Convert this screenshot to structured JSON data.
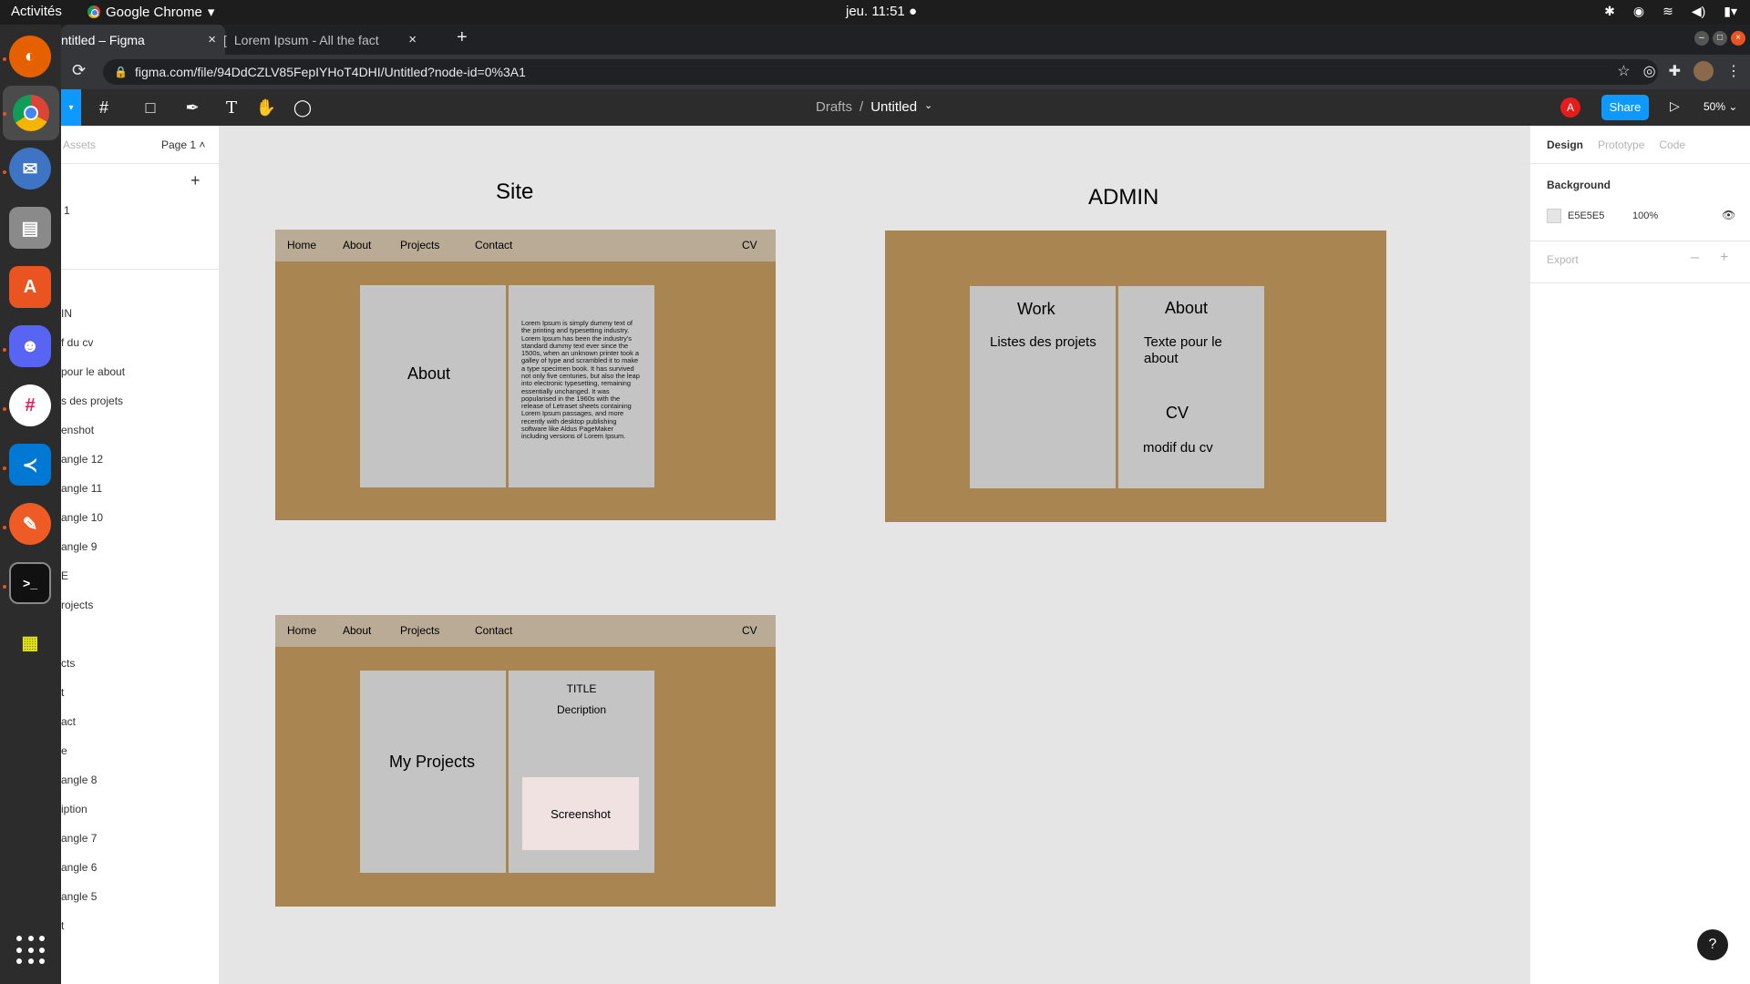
{
  "os": {
    "activities": "Activités",
    "app_name": "Google Chrome",
    "clock": "jeu. 11:51 ●"
  },
  "browser": {
    "tabs": [
      {
        "title": "ntitled – Figma",
        "close": "×"
      },
      {
        "title": "Lorem Ipsum - All the fact",
        "close": "×"
      }
    ],
    "new_tab": "+",
    "url": "figma.com/file/94DdCZLV85FepIYHoT4DHI/Untitled?node-id=0%3A1"
  },
  "figma": {
    "breadcrumb": {
      "drafts": "Drafts",
      "separator": "/",
      "file": "Untitled"
    },
    "user_initial": "A",
    "share": "Share",
    "zoom": "50%",
    "left_panel": {
      "assets": "Assets",
      "page_selector": "Page 1",
      "page_item": "1",
      "layers": [
        "IN",
        "f du cv",
        "pour le about",
        "s des projets",
        "enshot",
        "angle 12",
        "angle 11",
        "angle 10",
        "angle 9",
        "E",
        "rojects",
        "cts",
        "t",
        "act",
        "e",
        "angle 8",
        "iption",
        "angle 7",
        "angle 6",
        "angle 5",
        "t"
      ]
    },
    "right_panel": {
      "tabs": [
        "Design",
        "Prototype",
        "Code"
      ],
      "background_label": "Background",
      "background_hex": "E5E5E5",
      "background_opacity": "100%",
      "export_label": "Export",
      "help": "?"
    }
  },
  "canvas": {
    "site_title": "Site",
    "admin_title": "ADMIN",
    "nav": {
      "home": "Home",
      "about": "About",
      "projects": "Projects",
      "contact": "Contact",
      "cv": "CV"
    },
    "about_frame": {
      "box_title": "About",
      "lorem": "Lorem Ipsum is simply dummy text of the printing and typesetting industry. Lorem Ipsum has been the industry's standard dummy text ever since the 1500s, when an unknown printer took a galley of type and scrambled it to make a type specimen book. It has survived not only five centuries, but also the leap into electronic typesetting, remaining essentially unchanged. It was popularised in the 1960s with the release of Letraset sheets containing Lorem Ipsum passages, and more recently with desktop publishing software like Aldus PageMaker including versions of Lorem Ipsum."
    },
    "projects_frame": {
      "box_title": "My Projects",
      "title": "TITLE",
      "description": "Decription",
      "screenshot": "Screenshot"
    },
    "admin_frame": {
      "work_title": "Work",
      "work_text": "Listes des projets",
      "about_title": "About",
      "about_text": "Texte pour le about",
      "cv_title": "CV",
      "cv_text": "modif du cv"
    }
  }
}
